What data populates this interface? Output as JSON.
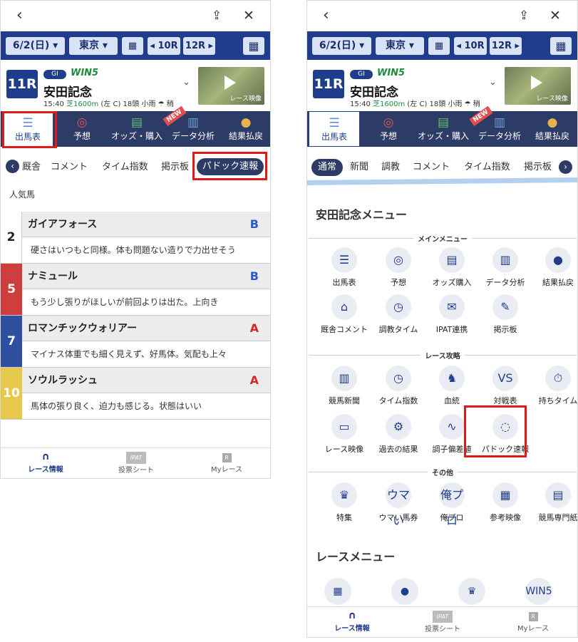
{
  "left": {
    "topbar": {
      "back_icon": "‹",
      "share_icon": "⇪",
      "close_icon": "✕"
    },
    "selectors": {
      "date": "6/2(日) ▾",
      "venue": "東京 ▾",
      "calendar_icon": "▦",
      "prev": "◂ 10R",
      "next": "12R ▸",
      "grid_icon": "▦"
    },
    "race": {
      "num": "11R",
      "grade": "GI",
      "win5": "WIN5",
      "name": "安田記念",
      "time": "15:40",
      "course": "芝1600m",
      "details": "(左 C) 18頭 小雨",
      "weather_icon": "☂",
      "track": "稍",
      "video_label": "レース映像"
    },
    "nav": [
      {
        "label": "出馬表",
        "icon": "☰"
      },
      {
        "label": "予想",
        "icon": "◎"
      },
      {
        "label": "オッズ・購入",
        "icon": "▤"
      },
      {
        "label": "データ分析",
        "icon": "▥",
        "badge": "NEW"
      },
      {
        "label": "結果払戻",
        "icon": "●"
      }
    ],
    "subtabs": [
      "厩舎",
      "コメント",
      "タイム指数",
      "掲示板",
      "パドック速報"
    ],
    "subtab_prev": "‹",
    "popular_label": "人気馬",
    "horses": [
      {
        "num": "2",
        "name": "ガイアフォース",
        "grade": "B",
        "comment": "硬さはいつもと同様。体も問題ない造りで力出せそう",
        "color": "#ffffff",
        "num_color": "#222222",
        "grade_color": "#2a5bc4"
      },
      {
        "num": "5",
        "name": "ナミュール",
        "grade": "B",
        "comment": "もう少し張りがほしいが前回よりは出た。上向き",
        "color": "#cf3e3e",
        "num_color": "#ffffff",
        "grade_color": "#2a5bc4"
      },
      {
        "num": "7",
        "name": "ロマンチックウォリアー",
        "grade": "A",
        "comment": "マイナス体重でも細く見えず、好馬体。気配も上々",
        "color": "#2f4fa0",
        "num_color": "#ffffff",
        "grade_color": "#d42a2a"
      },
      {
        "num": "10",
        "name": "ソウルラッシュ",
        "grade": "A",
        "comment": "馬体の張り良く、迫力も感じる。状態はいい",
        "color": "#e6c84b",
        "num_color": "#ffffff",
        "grade_color": "#d42a2a"
      }
    ],
    "bottom": [
      {
        "label": "レース情報",
        "icon": "∩"
      },
      {
        "label": "投票シート",
        "icon": "IPAT"
      },
      {
        "label": "Myレース",
        "icon": "R"
      }
    ]
  },
  "right": {
    "topbar": {
      "back_icon": "‹",
      "share_icon": "⇪",
      "close_icon": "✕"
    },
    "selectors": {
      "date": "6/2(日) ▾",
      "venue": "東京 ▾",
      "calendar_icon": "▦",
      "prev": "◂ 10R",
      "next": "12R ▸",
      "grid_icon": "▦"
    },
    "race": {
      "num": "11R",
      "grade": "GI",
      "win5": "WIN5",
      "name": "安田記念",
      "time": "15:40",
      "course": "芝1600m",
      "details": "(左 C) 18頭 小雨",
      "weather_icon": "☂",
      "track": "稍",
      "video_label": "レース映像"
    },
    "nav": [
      {
        "label": "出馬表",
        "icon": "☰"
      },
      {
        "label": "予想",
        "icon": "◎"
      },
      {
        "label": "オッズ・購入",
        "icon": "▤"
      },
      {
        "label": "データ分析",
        "icon": "▥",
        "badge": "NEW"
      },
      {
        "label": "結果払戻",
        "icon": "●"
      }
    ],
    "subtabs": [
      "通常",
      "新聞",
      "調教",
      "コメント",
      "タイム指数",
      "掲示板"
    ],
    "subtab_next": "›",
    "menu_title": "安田記念メニュー",
    "sections": [
      "メインメニュー",
      "レース攻略",
      "その他"
    ],
    "main_menu": [
      {
        "label": "出馬表",
        "icon": "☰"
      },
      {
        "label": "予想",
        "icon": "◎"
      },
      {
        "label": "オッズ購入",
        "icon": "▤"
      },
      {
        "label": "データ分析",
        "icon": "▥"
      },
      {
        "label": "結果払戻",
        "icon": "●"
      },
      {
        "label": "厩舎コメント",
        "icon": "⌂"
      },
      {
        "label": "調教タイム",
        "icon": "◷"
      },
      {
        "label": "IPAT連携",
        "icon": "✉"
      },
      {
        "label": "掲示板",
        "icon": "✎"
      }
    ],
    "strategy_menu": [
      {
        "label": "競馬新聞",
        "icon": "▥"
      },
      {
        "label": "タイム指数",
        "icon": "◷"
      },
      {
        "label": "血統",
        "icon": "♞"
      },
      {
        "label": "対戦表",
        "icon": "VS"
      },
      {
        "label": "持ちタイム",
        "icon": "⏱"
      },
      {
        "label": "レース映像",
        "icon": "▭"
      },
      {
        "label": "過去の結果",
        "icon": "⚙"
      },
      {
        "label": "調子偏差値",
        "icon": "∿"
      },
      {
        "label": "パドック速報",
        "icon": "◌"
      }
    ],
    "other_menu": [
      {
        "label": "特集",
        "icon": "♛"
      },
      {
        "label": "ウマい馬券",
        "icon": "ウマい"
      },
      {
        "label": "俺プロ",
        "icon": "俺プロ"
      },
      {
        "label": "参考映像",
        "icon": "▦"
      },
      {
        "label": "競馬専門紙",
        "icon": "▤"
      }
    ],
    "race_menu_title": "レースメニュー",
    "race_menu": [
      {
        "icon": "▦"
      },
      {
        "icon": "●"
      },
      {
        "icon": "♛"
      },
      {
        "icon": "WIN5"
      }
    ],
    "bottom": [
      {
        "label": "レース情報",
        "icon": "∩"
      },
      {
        "label": "投票シート",
        "icon": "IPAT"
      },
      {
        "label": "Myレース",
        "icon": "R"
      }
    ]
  }
}
